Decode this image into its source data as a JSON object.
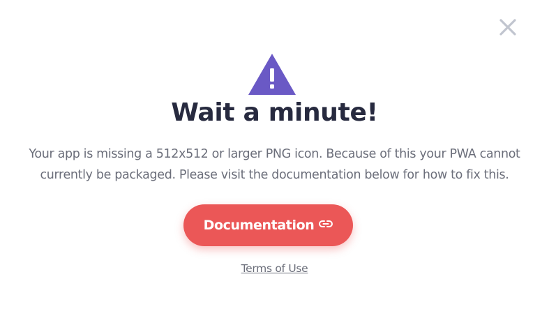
{
  "dialog": {
    "close_icon": "close-icon",
    "warning_icon": "warning-triangle-icon",
    "title": "Wait a minute!",
    "message_line1": "Your app is missing a 512x512 or larger PNG icon. Because of this your PWA cannot",
    "message_line2": "currently be packaged. Please visit the documentation below for how to fix this.",
    "documentation_button_label": "Documentation",
    "documentation_button_icon": "link-icon",
    "terms_link_label": "Terms of Use"
  },
  "colors": {
    "accent_button": "#eb5757",
    "warning_icon": "#6a59c5",
    "title": "#272a3f",
    "body_text": "#6b6e7a",
    "close_icon": "#c1c5cf"
  }
}
